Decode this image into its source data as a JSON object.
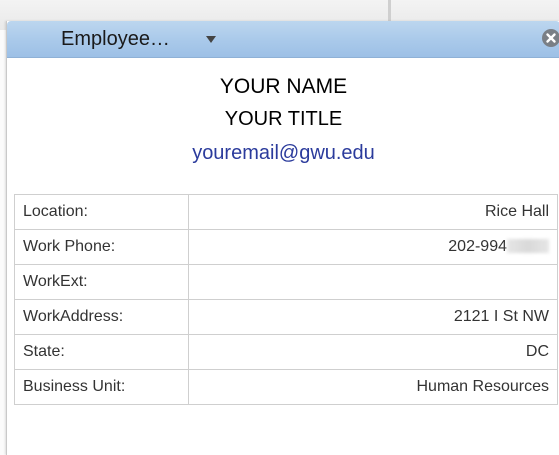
{
  "window": {
    "title": "Employee…"
  },
  "profile": {
    "name": "YOUR NAME",
    "title": "YOUR TITLE",
    "email": "youremail@gwu.edu"
  },
  "details": [
    {
      "label": "Location:",
      "value": "Rice Hall"
    },
    {
      "label": "Work Phone:",
      "value": "202-994"
    },
    {
      "label": "WorkExt:",
      "value": ""
    },
    {
      "label": "WorkAddress:",
      "value": "2121 I St NW"
    },
    {
      "label": "State:",
      "value": "DC"
    },
    {
      "label": "Business Unit:",
      "value": "Human Resources"
    }
  ],
  "icons": {
    "dropdown": "chevron-down-icon",
    "close": "close-icon"
  },
  "colors": {
    "titlebar": "#a9c9ea",
    "email_link": "#2b3b9c",
    "border": "#cfcfcf"
  }
}
